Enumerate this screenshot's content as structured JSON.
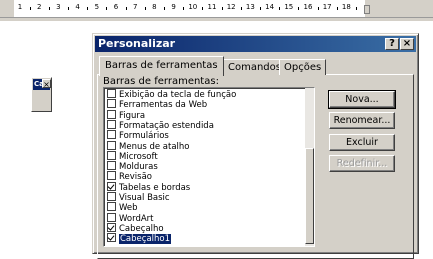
{
  "ruler": {
    "labels": [
      "1",
      "2",
      "3",
      "4",
      "5",
      "6",
      "7",
      "8",
      "9",
      "10",
      "11",
      "12",
      "13",
      "14",
      "15",
      "16",
      "17",
      "18"
    ]
  },
  "mini_toolbar": {
    "title": "Cal",
    "close": "×"
  },
  "dialog": {
    "title": "Personalizar",
    "help_button": "?",
    "close_button": "×",
    "tabs": [
      "Barras de ferramentas",
      "Comandos",
      "Opções"
    ],
    "list_label": "Barras de ferramentas:",
    "items": [
      {
        "label": "Exibição da tecla de função",
        "checked": false,
        "selected": false
      },
      {
        "label": "Ferramentas da Web",
        "checked": false,
        "selected": false
      },
      {
        "label": "Figura",
        "checked": false,
        "selected": false
      },
      {
        "label": "Formatação estendida",
        "checked": false,
        "selected": false
      },
      {
        "label": "Formulários",
        "checked": false,
        "selected": false
      },
      {
        "label": "Menus de atalho",
        "checked": false,
        "selected": false
      },
      {
        "label": "Microsoft",
        "checked": false,
        "selected": false
      },
      {
        "label": "Molduras",
        "checked": false,
        "selected": false
      },
      {
        "label": "Revisão",
        "checked": false,
        "selected": false
      },
      {
        "label": "Tabelas e bordas",
        "checked": true,
        "selected": false
      },
      {
        "label": "Visual Basic",
        "checked": false,
        "selected": false
      },
      {
        "label": "Web",
        "checked": false,
        "selected": false
      },
      {
        "label": "WordArt",
        "checked": false,
        "selected": false
      },
      {
        "label": "Cabeçalho",
        "checked": true,
        "selected": false
      },
      {
        "label": "Cabeçalho1",
        "checked": true,
        "selected": true
      }
    ],
    "buttons": {
      "new": "Nova...",
      "rename": "Renomear...",
      "delete": "Excluir",
      "reset": "Redefinir..."
    }
  }
}
